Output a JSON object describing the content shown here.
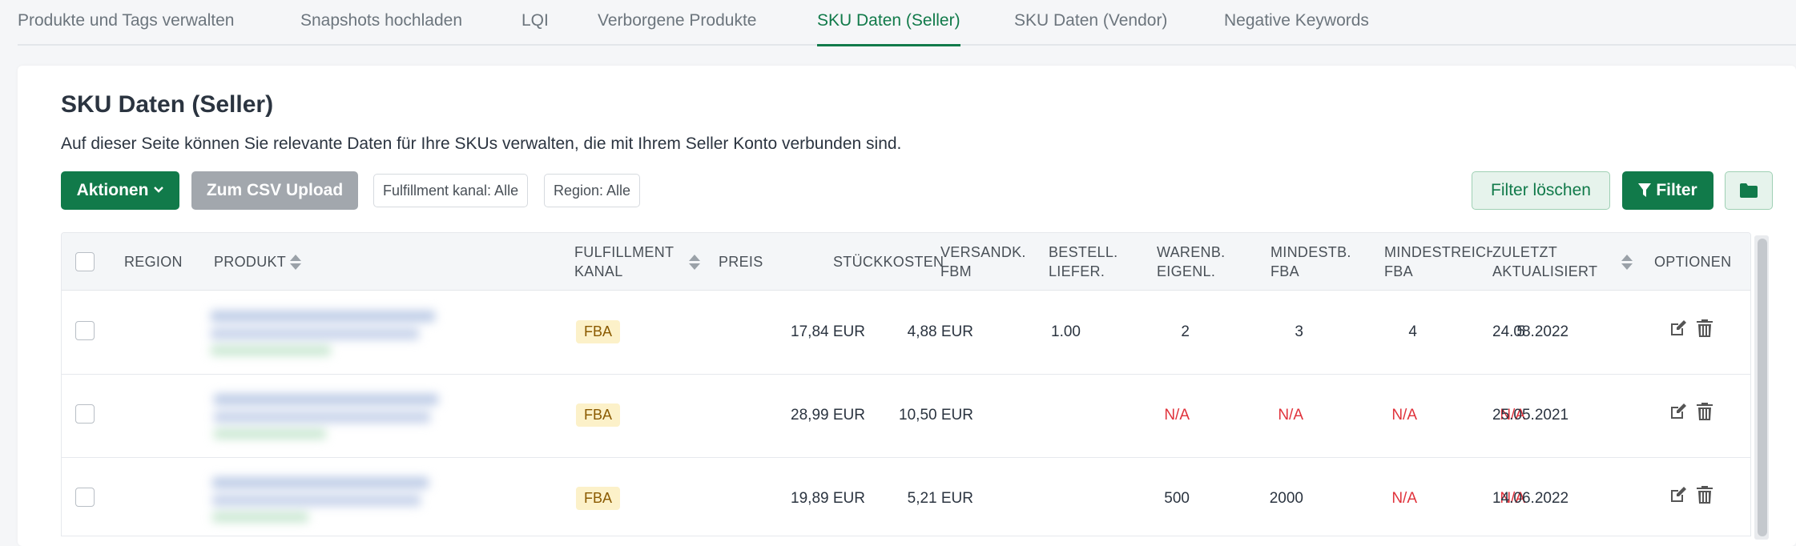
{
  "tabs": [
    {
      "label": "Produkte und Tags verwalten"
    },
    {
      "label": "Snapshots hochladen"
    },
    {
      "label": "LQI"
    },
    {
      "label": "Verborgene Produkte"
    },
    {
      "label": "SKU Daten (Seller)"
    },
    {
      "label": "SKU Daten (Vendor)"
    },
    {
      "label": "Negative Keywords"
    }
  ],
  "active_tab": "SKU Daten (Seller)",
  "page": {
    "title": "SKU Daten (Seller)",
    "description": "Auf dieser Seite können Sie relevante Daten für Ihre SKUs verwalten, die mit Ihrem Seller Konto verbunden sind."
  },
  "toolbar": {
    "actions_label": "Aktionen",
    "csv_label": "Zum CSV Upload",
    "fulfillment_filter": "Fulfillment kanal: Alle",
    "region_filter": "Region: Alle",
    "clear_filter_label": "Filter löschen",
    "filter_label": "Filter"
  },
  "columns": {
    "region": "REGION",
    "produkt": "PRODUKT",
    "fulfillment_1": "FULFILLMENT",
    "fulfillment_2": "KANAL",
    "preis": "PREIS",
    "stueckkosten": "STÜCKKOSTEN",
    "versandk_1": "VERSANDK.",
    "versandk_2": "FBM",
    "bestell_1": "BESTELL.",
    "bestell_2": "LIEFER.",
    "warenb_1": "WARENB.",
    "warenb_2": "EIGENL.",
    "mindestb_1": "MINDESTB.",
    "mindestb_2": "FBA",
    "mindestreich_1": "MINDESTREICHW.",
    "mindestreich_2": "FBA",
    "zuletzt_1": "ZULETZT",
    "zuletzt_2": "AKTUALISIERT",
    "optionen": "OPTIONEN"
  },
  "rows": [
    {
      "fulfillment": "FBA",
      "preis": "17,84 EUR",
      "stueckkosten": "4,88 EUR",
      "versandk": "1.00",
      "bestell": "2",
      "warenb": "3",
      "mindestb": "4",
      "mindestreich": "5",
      "zuletzt": "24.08.2022"
    },
    {
      "fulfillment": "FBA",
      "preis": "28,99 EUR",
      "stueckkosten": "10,50 EUR",
      "versandk": "",
      "bestell": "N/A",
      "warenb": "N/A",
      "mindestb": "N/A",
      "mindestreich": "N/A",
      "zuletzt": "25.05.2021"
    },
    {
      "fulfillment": "FBA",
      "preis": "19,89 EUR",
      "stueckkosten": "5,21 EUR",
      "versandk": "",
      "bestell": "500",
      "warenb": "2000",
      "mindestb": "N/A",
      "mindestreich": "N/A",
      "zuletzt": "14.06.2022"
    }
  ],
  "icons": {
    "chevron": "chevron-down-icon",
    "filter": "filter-icon",
    "folder": "folder-icon",
    "edit": "edit-icon",
    "delete": "trash-icon"
  },
  "colors": {
    "brand_green": "#117a4a",
    "na_red": "#e0323b",
    "badge_bg": "#fcf1c9"
  }
}
